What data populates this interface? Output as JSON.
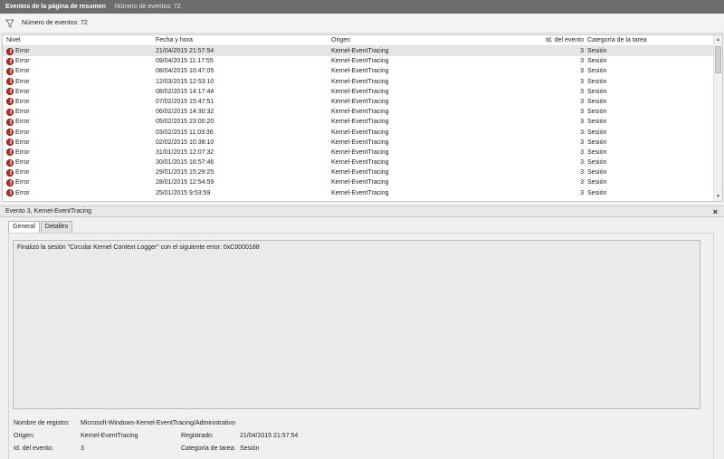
{
  "titlebar": {
    "title": "Eventos de la página de resumen",
    "count": "Número de eventos: 72"
  },
  "filter": {
    "count_label": "Número de eventos: 72"
  },
  "grid": {
    "headers": {
      "nivel": "Nivel",
      "fecha": "Fecha y hora",
      "origen": "Origen",
      "id": "Id. del evento",
      "categoria": "Categoría de la tarea"
    },
    "rows": [
      {
        "nivel": "Error",
        "fecha": "21/04/2015 21:57:54",
        "origen": "Kernel-EventTracing",
        "id": "3",
        "categoria": "Sesión"
      },
      {
        "nivel": "Error",
        "fecha": "09/04/2015 11:17:55",
        "origen": "Kernel-EventTracing",
        "id": "3",
        "categoria": "Sesión"
      },
      {
        "nivel": "Error",
        "fecha": "08/04/2015 10:47:05",
        "origen": "Kernel-EventTracing",
        "id": "3",
        "categoria": "Sesión"
      },
      {
        "nivel": "Error",
        "fecha": "12/03/2015 12:53:10",
        "origen": "Kernel-EventTracing",
        "id": "3",
        "categoria": "Sesión"
      },
      {
        "nivel": "Error",
        "fecha": "08/02/2015 14:17:44",
        "origen": "Kernel-EventTracing",
        "id": "3",
        "categoria": "Sesión"
      },
      {
        "nivel": "Error",
        "fecha": "07/02/2015 15:47:51",
        "origen": "Kernel-EventTracing",
        "id": "3",
        "categoria": "Sesión"
      },
      {
        "nivel": "Error",
        "fecha": "06/02/2015 14:30:32",
        "origen": "Kernel-EventTracing",
        "id": "3",
        "categoria": "Sesión"
      },
      {
        "nivel": "Error",
        "fecha": "05/02/2015 23:00:20",
        "origen": "Kernel-EventTracing",
        "id": "3",
        "categoria": "Sesión"
      },
      {
        "nivel": "Error",
        "fecha": "03/02/2015 11:03:36",
        "origen": "Kernel-EventTracing",
        "id": "3",
        "categoria": "Sesión"
      },
      {
        "nivel": "Error",
        "fecha": "02/02/2015 10:38:10",
        "origen": "Kernel-EventTracing",
        "id": "3",
        "categoria": "Sesión"
      },
      {
        "nivel": "Error",
        "fecha": "31/01/2015 12:07:32",
        "origen": "Kernel-EventTracing",
        "id": "3",
        "categoria": "Sesión"
      },
      {
        "nivel": "Error",
        "fecha": "30/01/2015 16:57:46",
        "origen": "Kernel-EventTracing",
        "id": "3",
        "categoria": "Sesión"
      },
      {
        "nivel": "Error",
        "fecha": "29/01/2015 15:29:25",
        "origen": "Kernel-EventTracing",
        "id": "3",
        "categoria": "Sesión"
      },
      {
        "nivel": "Error",
        "fecha": "28/01/2015 12:54:59",
        "origen": "Kernel-EventTracing",
        "id": "3",
        "categoria": "Sesión"
      },
      {
        "nivel": "Error",
        "fecha": "25/01/2015 9:53:59",
        "origen": "Kernel-EventTracing",
        "id": "3",
        "categoria": "Sesión"
      }
    ]
  },
  "detail": {
    "title": "Evento 3, Kernel-EventTracing",
    "close": "×",
    "tabs": [
      "General",
      "Detalles"
    ],
    "description": "Finalizó la sesión \"Circular Kernel Context Logger\" con el siguiente error: 0xC0000188",
    "props": {
      "registro_label": "Nombre de registro:",
      "registro_value": "Microsoft-Windows-Kernel-EventTracing/Administrativo",
      "origen_label": "Origen:",
      "origen_value": "Kernel-EventTracing",
      "registrado_label": "Registrado:",
      "registrado_value": "21/04/2015 21:57:54",
      "id_label": "Id. del evento:",
      "id_value": "3",
      "categoria_label": "Categoría de tarea:",
      "categoria_value": "Sesión"
    }
  },
  "colors": {
    "titlebar": "#6d6d6d",
    "error": "#c42b1c",
    "selected_row": "#e6e6e6"
  }
}
